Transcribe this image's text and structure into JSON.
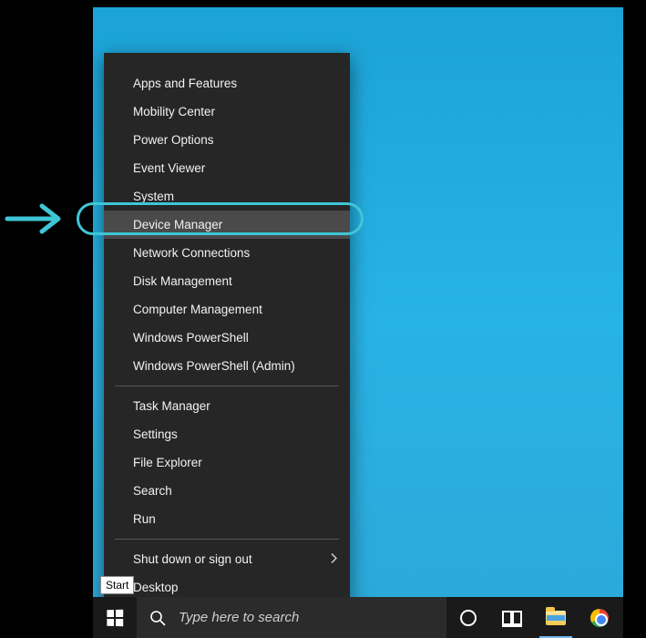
{
  "menu": {
    "group1": [
      "Apps and Features",
      "Mobility Center",
      "Power Options",
      "Event Viewer",
      "System",
      "Device Manager",
      "Network Connections",
      "Disk Management",
      "Computer Management",
      "Windows PowerShell",
      "Windows PowerShell (Admin)"
    ],
    "group2": [
      "Task Manager",
      "Settings",
      "File Explorer",
      "Search",
      "Run"
    ],
    "group3": [
      "Shut down or sign out",
      "Desktop"
    ],
    "highlighted_index": 5
  },
  "taskbar": {
    "search_placeholder": "Type here to search"
  },
  "tooltip": {
    "start": "Start"
  },
  "annotation": {
    "highlight_color": "#3ec6d6"
  }
}
